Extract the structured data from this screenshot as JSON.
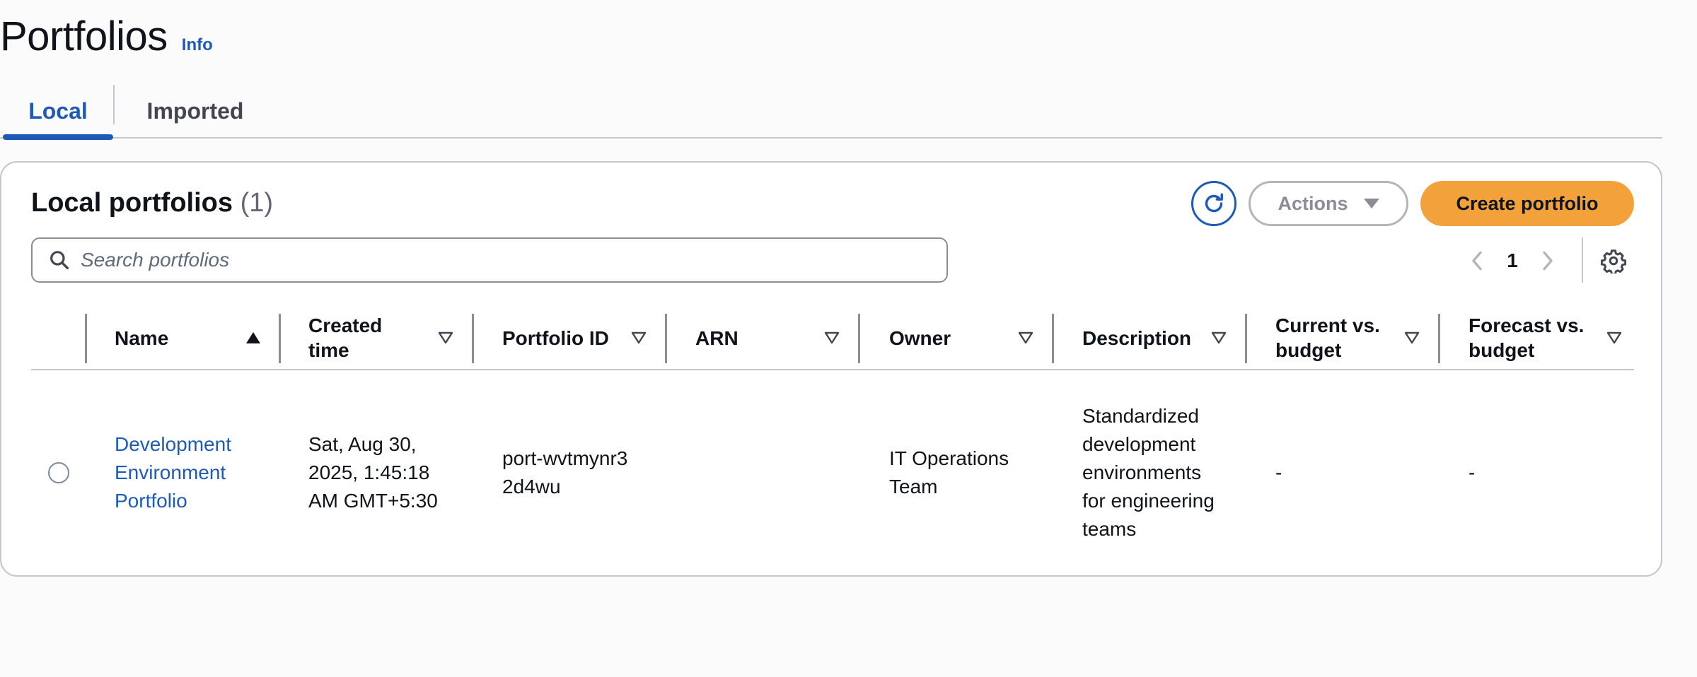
{
  "header": {
    "title": "Portfolios",
    "info_label": "Info"
  },
  "tabs": [
    {
      "label": "Local",
      "active": true
    },
    {
      "label": "Imported",
      "active": false
    }
  ],
  "panel": {
    "title": "Local portfolios",
    "count": "(1)",
    "actions_label": "Actions",
    "create_label": "Create portfolio",
    "search_placeholder": "Search portfolios",
    "page": "1"
  },
  "table": {
    "columns": [
      {
        "label": "Name",
        "sort": "ascending"
      },
      {
        "label": "Created time",
        "sort": "none"
      },
      {
        "label": "Portfolio ID",
        "sort": "none"
      },
      {
        "label": "ARN",
        "sort": "none"
      },
      {
        "label": "Owner",
        "sort": "none"
      },
      {
        "label": "Description",
        "sort": "none"
      },
      {
        "label": "Current vs. budget",
        "sort": "none"
      },
      {
        "label": "Forecast vs. budget",
        "sort": "none"
      }
    ],
    "rows": [
      {
        "name": "Development Environment Portfolio",
        "created_time": "Sat, Aug 30, 2025, 1:45:18 AM GMT+5:30",
        "portfolio_id": "port-wvtmynr32d4wu",
        "arn": "",
        "owner": "IT Operations Team",
        "description": "Standardized development environments for engineering teams",
        "current_vs_budget": "-",
        "forecast_vs_budget": "-"
      }
    ]
  },
  "colors": {
    "link": "#1e5bb8",
    "primary_button": "#f3a23b",
    "border": "#c6c6cd",
    "text": "#0f141a"
  },
  "icons": [
    "search-icon",
    "refresh-icon",
    "caret-down-icon",
    "chevron-left-icon",
    "chevron-right-icon",
    "gear-icon",
    "sort-ascending-icon",
    "sort-icon"
  ]
}
